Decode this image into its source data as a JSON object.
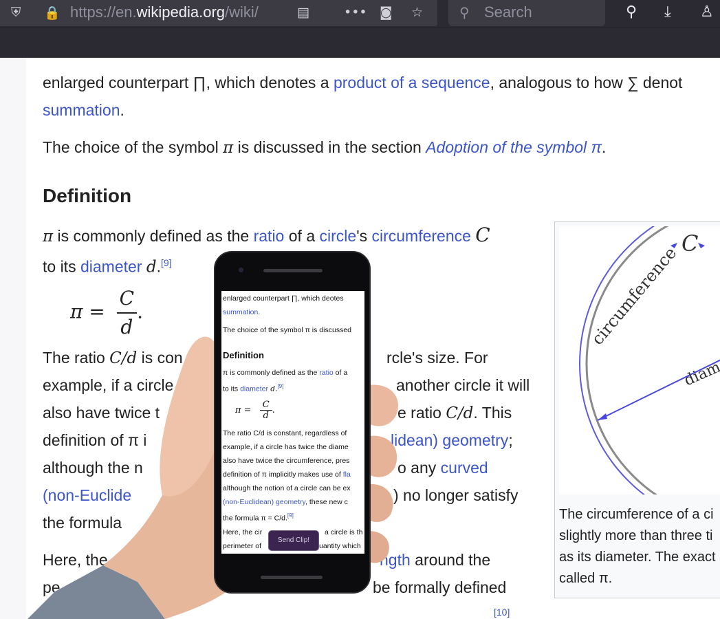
{
  "browser": {
    "url_prefix": "https://en.",
    "url_host": "wikipedia.org",
    "url_suffix": "/wiki/",
    "search_placeholder": "Search",
    "icons": [
      "shield-icon",
      "lock-icon",
      "reader-view-icon",
      "more-icon",
      "pocket-icon",
      "star-icon",
      "search-icon",
      "download-icon",
      "account-icon"
    ]
  },
  "article": {
    "p1_line1_a": "enlarged counterpart ∏, which denotes a ",
    "p1_link1": "product of a sequence",
    "p1_line1_b": ", analogous to how ∑ denot",
    "p1_link2": "summation",
    "p1_line2_end": ".",
    "p2_a": "The choice of the symbol ",
    "p2_pi": "π",
    "p2_b": " is discussed in the section ",
    "p2_link": "Adoption of the symbol π",
    "p2_end": ".",
    "heading": "Definition",
    "p3_pi": "π",
    "p3_a": " is commonly defined as the ",
    "p3_link_ratio": "ratio",
    "p3_b": " of a ",
    "p3_link_circle": "circle",
    "p3_c": "'s ",
    "p3_link_circ": "circumference",
    "p3_C": "C",
    "p3_line2_a": "to its ",
    "p3_link_diam": "diameter",
    "p3_d": "d",
    "p3_ref": "[9]",
    "formula_lhs": "π =",
    "formula_num": "C",
    "formula_den": "d",
    "formula_end": ".",
    "p4_l1_a": "The ratio ",
    "p4_l1_math": "C/d",
    "p4_l1_b": " is con",
    "p4_l1_c": "rcle's size. For",
    "p4_l2_a": "example, if a circle",
    "p4_l2_b": "another circle it will",
    "p4_l3_a": "also have twice t",
    "p4_l3_b": "e ratio ",
    "p4_l3_math": "C/d",
    "p4_l3_c": ". This",
    "p4_l4_a": "definition of π i",
    "p4_l4_link": "lidean) geometry",
    "p4_l4_b": ";",
    "p4_l5_a": "although the n",
    "p4_l5_b": "o any ",
    "p4_l5_link": "curved",
    "p4_l6_link": "(non-Euclide",
    "p4_l6_b": ") no longer satisfy",
    "p4_l7_a": "the formula ",
    "p5_l1_a": "Here, the c",
    "p5_l1_link": "ngth",
    "p5_l1_b": " around the",
    "p5_l2_a": "pe",
    "p5_l2_b": "be formally defined",
    "p5_ref": "[10]"
  },
  "figure": {
    "label_circumference": "circumference",
    "label_C": "C",
    "label_d": "d",
    "label_diameter": "diam",
    "caption_l1": "The circumference of a ci",
    "caption_l2": "slightly more than three ti",
    "caption_l3": "as its diameter. The exact",
    "caption_l4": "called π."
  },
  "phone": {
    "l1": "enlarged counterpart ∏, which de",
    "l1_b": "otes",
    "l2_link": "summation",
    "l2_end": ".",
    "l3": "The choice of the symbol π is discussed",
    "heading": "Definition",
    "l4_a": "π is commonly defined as the ",
    "l4_link": "ratio",
    "l4_b": " of a",
    "l5_a": "to its ",
    "l5_link": "diameter",
    "l5_d": " d.",
    "l5_ref": "[9]",
    "formula_lhs": "π =",
    "formula_num": "C",
    "formula_den": "d",
    "formula_end": ".",
    "l6": "The ratio C/d is constant, regardless of",
    "l7": "example, if a circle has twice the diame",
    "l8": "also have twice the circumference, pres",
    "l9_a": "definition of π implicitly makes use of ",
    "l9_link": "fla",
    "l10": "although the notion of a circle can be ex",
    "l11_link": "(non-Euclidean) geometry",
    "l11_b": ", these new c",
    "l12_a": "the formula π = C/d.",
    "l12_ref": "[9]",
    "l13": "Here, the cir",
    "l13_b": "a circle is th",
    "l14": "perimeter of",
    "l14_b": "uantity which",
    "send_clip": "Send Clip!"
  }
}
